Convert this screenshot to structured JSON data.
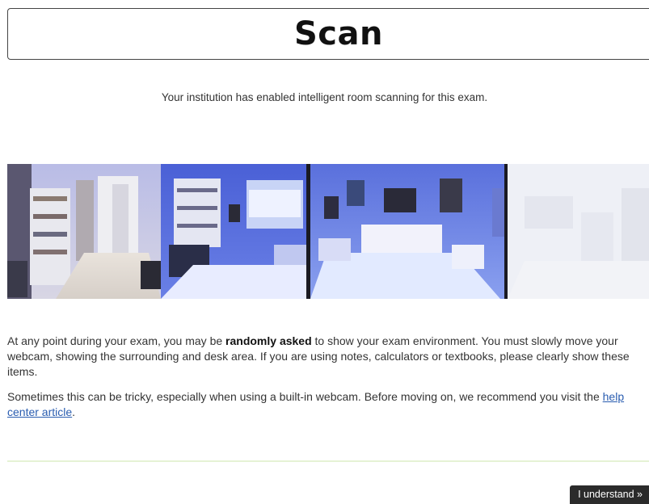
{
  "header": {
    "title": "Scan"
  },
  "intro_text": "Your institution has enabled intelligent room scanning for this exam.",
  "panorama": {
    "icon": "room-panorama-image"
  },
  "body": {
    "p1_before": "At any point during your exam, you may be ",
    "p1_bold": "randomly asked",
    "p1_after": " to show your exam environment. You must slowly move your webcam, showing the surrounding and desk area. If you are using notes, calculators or textbooks, please clearly show these items.",
    "p2_before": "Sometimes this can be tricky, especially when using a built-in webcam. Before moving on, we recommend you visit the ",
    "p2_link": "help center article",
    "p2_after": "."
  },
  "footer": {
    "understand_label": "I understand »"
  },
  "colors": {
    "link": "#2a5db0",
    "button_bg": "#2b2b2b",
    "divider": "#e6f2d5"
  }
}
